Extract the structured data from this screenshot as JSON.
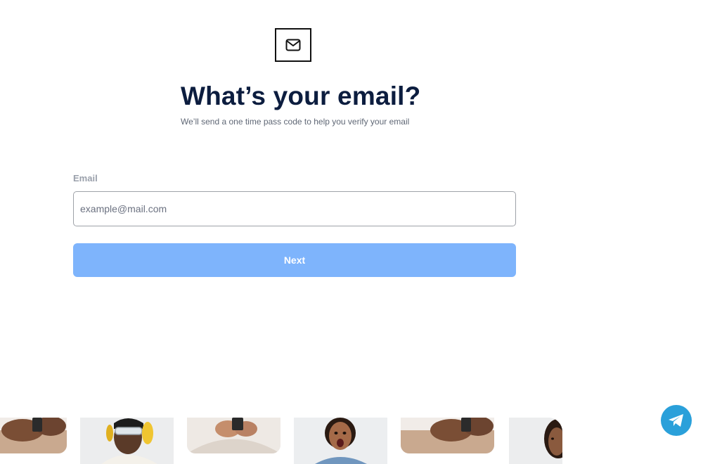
{
  "header": {
    "icon": "mail-icon",
    "title": "What’s your email?",
    "subtitle": "We’ll send a one time pass code to help you verify your email"
  },
  "form": {
    "email_label": "Email",
    "email_placeholder": "example@mail.com",
    "email_value": "",
    "next_label": "Next"
  },
  "carousel": {
    "photos": [
      "person-holding-phone-photo",
      "person-with-safety-glasses-and-earmuffs-photo",
      "person-typing-on-phone-photo",
      "surprised-woman-photo",
      "person-holding-phone-photo",
      "woman-portrait-photo"
    ]
  },
  "fab": {
    "icon": "telegram-icon"
  },
  "colors": {
    "title": "#0c1d3f",
    "button": "#7eb4fc",
    "telegram": "#2aa0da"
  }
}
